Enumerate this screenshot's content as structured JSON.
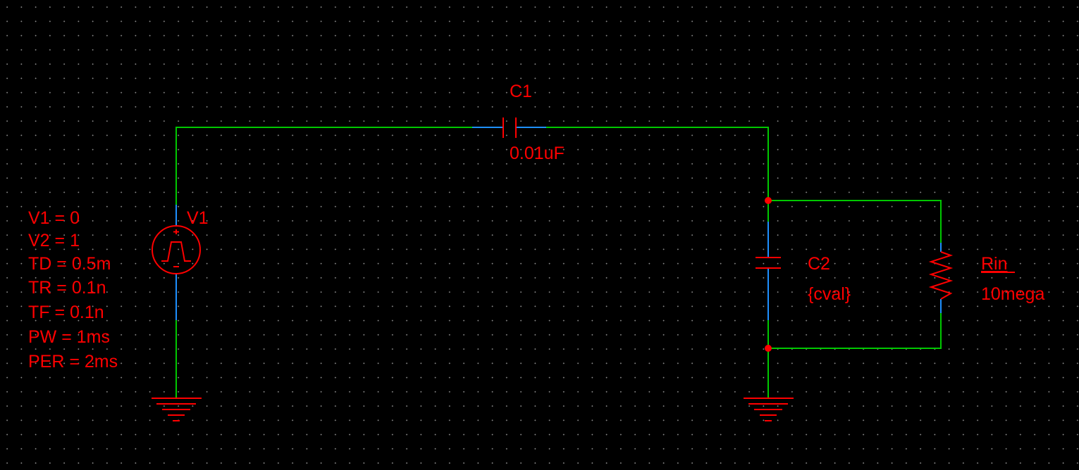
{
  "schematic": {
    "colors": {
      "background": "#000000",
      "grid_dot": "#8a8a8a",
      "wire": "#00c800",
      "pin": "#1e90ff",
      "part": "#ff0000",
      "label": "#ff0000"
    },
    "source_v1": {
      "icon": "pulse-voltage-source-icon",
      "ref": "V1",
      "params": [
        "V1 = 0",
        "V2 = 1",
        "TD = 0.5m",
        "TR = 0.1n",
        "TF = 0.1n",
        "PW = 1ms",
        "PER = 2ms"
      ]
    },
    "capacitor_c1": {
      "icon": "capacitor-icon",
      "ref": "C1",
      "value": "0.01uF"
    },
    "capacitor_c2": {
      "icon": "capacitor-icon",
      "ref": "C2",
      "value": "{cval}"
    },
    "resistor_rin": {
      "icon": "resistor-icon",
      "ref": "Rin",
      "value": "10mega"
    },
    "grounds": [
      "ground-icon",
      "ground-icon"
    ]
  }
}
